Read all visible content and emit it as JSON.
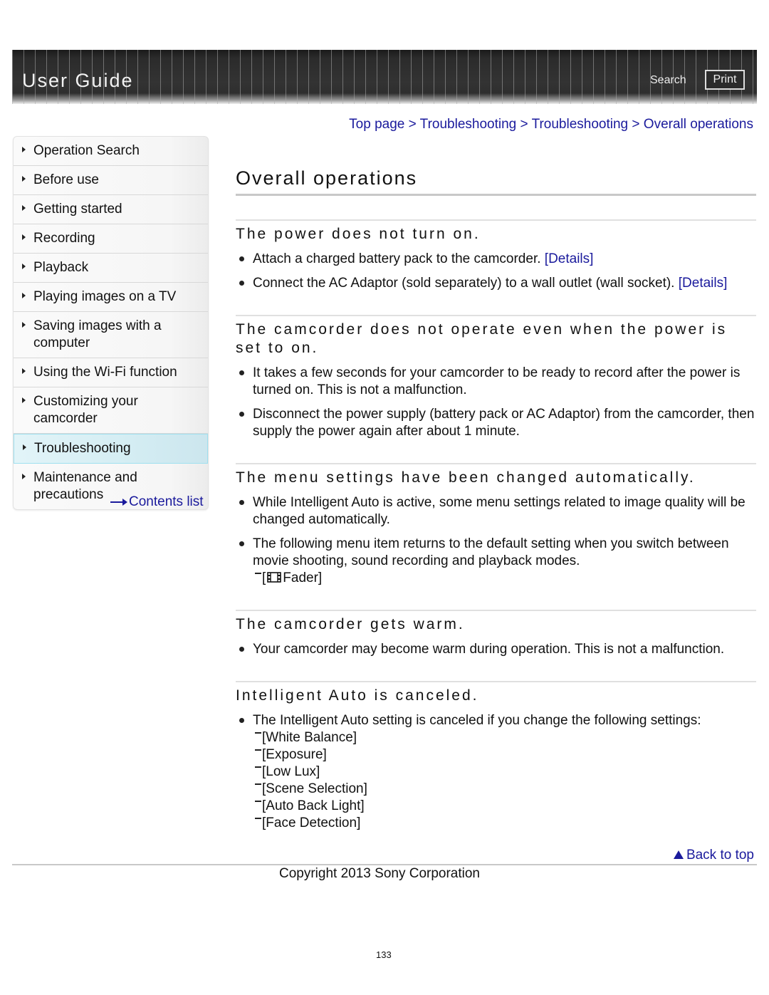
{
  "header": {
    "title": "User Guide",
    "search_label": "Search",
    "print_label": "Print"
  },
  "breadcrumb": {
    "items": [
      "Top page",
      "Troubleshooting",
      "Troubleshooting",
      "Overall operations"
    ],
    "separator": ">"
  },
  "sidebar": {
    "items": [
      {
        "label": "Operation Search"
      },
      {
        "label": "Before use"
      },
      {
        "label": "Getting started"
      },
      {
        "label": "Recording"
      },
      {
        "label": "Playback"
      },
      {
        "label": "Playing images on a TV"
      },
      {
        "label": "Saving images with a computer"
      },
      {
        "label": "Using the Wi-Fi function"
      },
      {
        "label": "Customizing your camcorder"
      },
      {
        "label": "Troubleshooting",
        "active": true
      },
      {
        "label": "Maintenance and precautions"
      }
    ],
    "contents_link": "Contents list"
  },
  "main": {
    "title": "Overall operations",
    "sections": [
      {
        "heading": "The power does not turn on.",
        "bullets": [
          {
            "text": "Attach a charged battery pack to the camcorder.",
            "link": "[Details]"
          },
          {
            "text": "Connect the AC Adaptor (sold separately) to a wall outlet (wall socket).",
            "link": "[Details]"
          }
        ]
      },
      {
        "heading": "The camcorder does not operate even when the power is set to on.",
        "bullets": [
          {
            "text": "It takes a few seconds for your camcorder to be ready to record after the power is turned on. This is not a malfunction."
          },
          {
            "text": "Disconnect the power supply (battery pack or AC Adaptor) from the camcorder, then supply the power again after about 1 minute."
          }
        ]
      },
      {
        "heading": "The menu settings have been changed automatically.",
        "bullets": [
          {
            "text": "While Intelligent Auto is active, some menu settings related to image quality will be changed automatically."
          },
          {
            "text": "The following menu item returns to the default setting when you switch between movie shooting, sound recording and playback modes.",
            "subitems": [
              {
                "icon": "film-icon",
                "label": "Fader]",
                "prefix": "["
              }
            ]
          }
        ]
      },
      {
        "heading": "The camcorder gets warm.",
        "bullets": [
          {
            "text": "Your camcorder may become warm during operation. This is not a malfunction."
          }
        ]
      },
      {
        "heading": "Intelligent Auto is canceled.",
        "bullets": [
          {
            "text": "The Intelligent Auto setting is canceled if you change the following settings:",
            "subitems": [
              "[White Balance]",
              "[Exposure]",
              "[Low Lux]",
              "[Scene Selection]",
              "[Auto Back Light]",
              "[Face Detection]"
            ]
          }
        ]
      }
    ]
  },
  "footer": {
    "back_to_top": "Back to top",
    "copyright": "Copyright 2013 Sony Corporation",
    "page_number": "133"
  },
  "colors": {
    "link": "#1a1a9c",
    "active_nav": "#d4edf3",
    "header_bg": "#2b2b2b"
  }
}
